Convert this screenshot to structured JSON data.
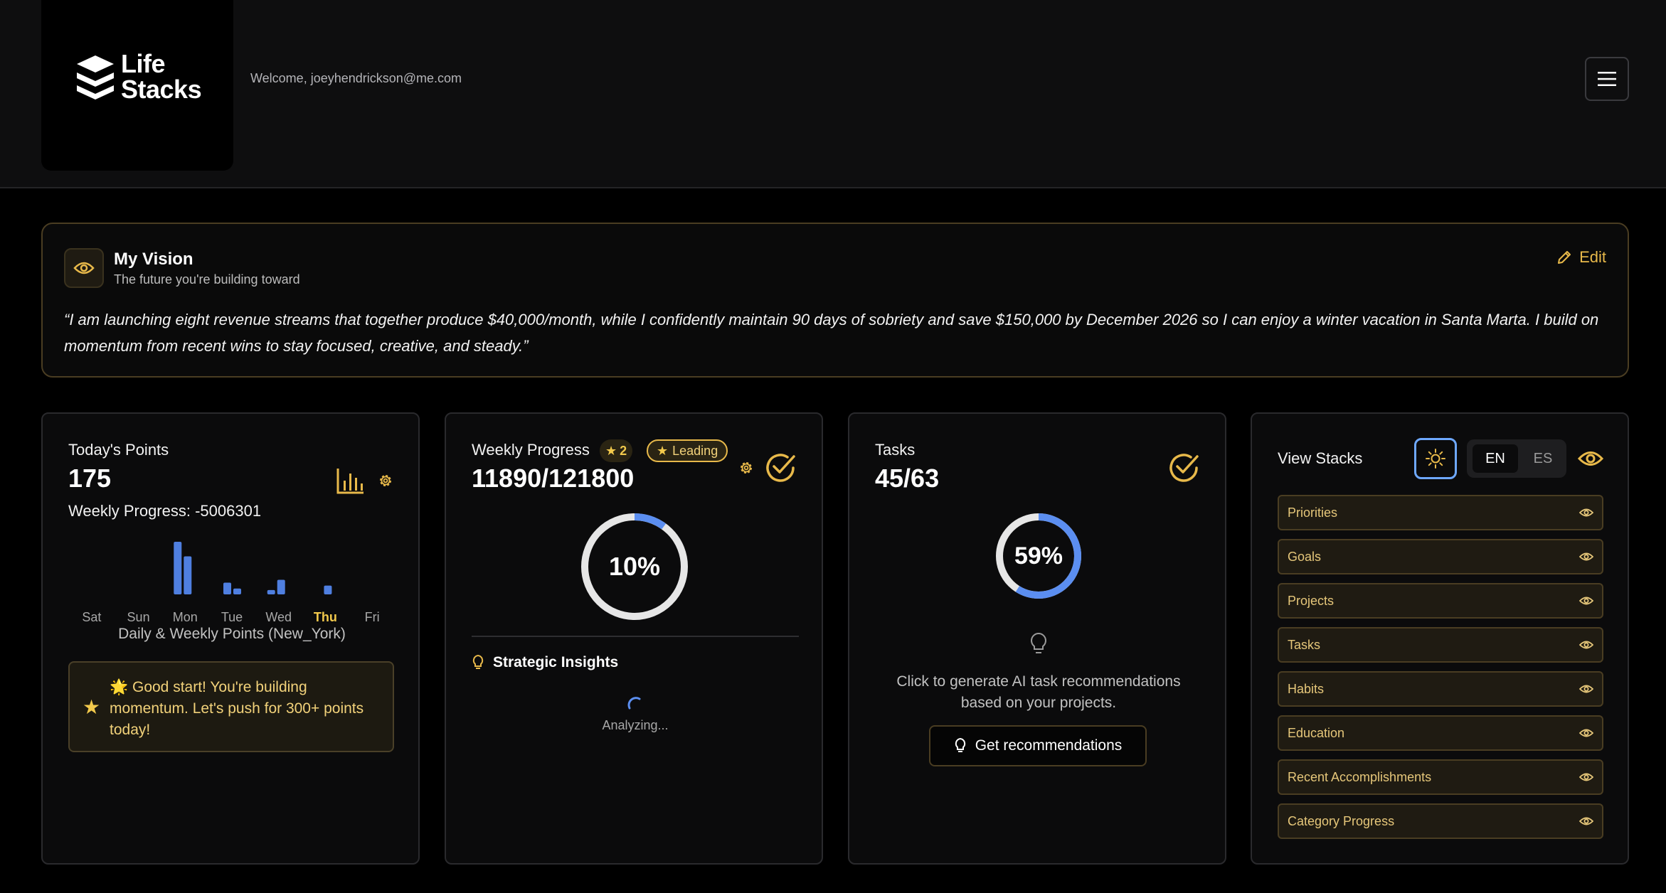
{
  "app": {
    "logo_line1": "Life",
    "logo_line2": "Stacks",
    "welcome": "Welcome, joeyhendrickson@me.com"
  },
  "vision": {
    "title": "My Vision",
    "subtitle": "The future you're building toward",
    "edit_label": "Edit",
    "quote": "“I am launching eight revenue streams that together produce $40,000/month, while I confidently maintain 90 days of sobriety and save $150,000 by December 2026 so I can enjoy a winter vacation in Santa Marta. I build on momentum from recent wins to stay focused, creative, and steady.”"
  },
  "points": {
    "label": "Today's Points",
    "value": "175",
    "weekly": "Weekly Progress: -5006301",
    "caption": "Daily & Weekly Points (New_York)",
    "tip": "🌟 Good start! You're building momentum. Let's push for 300+ points today!"
  },
  "chart_data": {
    "type": "bar",
    "categories": [
      "Sat",
      "Sun",
      "Mon",
      "Tue",
      "Wed",
      "Thu",
      "Fri"
    ],
    "highlight": "Thu",
    "series": [
      {
        "values": [
          0,
          0,
          72,
          16,
          6,
          0,
          0
        ]
      },
      {
        "values": [
          0,
          0,
          52,
          8,
          20,
          12,
          0
        ]
      }
    ],
    "title": "Daily & Weekly Points (New_York)",
    "color": "#4f7fe0",
    "highlight_color": "#f2c94c"
  },
  "weekly_progress": {
    "label": "Weekly Progress",
    "star_count": "2",
    "leading_label": "Leading",
    "value": "11890/121800",
    "percent_label": "10%",
    "percent": 10,
    "insights_label": "Strategic Insights",
    "analyzing": "Analyzing..."
  },
  "tasks": {
    "label": "Tasks",
    "value": "45/63",
    "percent_label": "59%",
    "percent": 59,
    "prompt": "Click to generate AI task recommendations based on your projects.",
    "button_label": "Get recommendations"
  },
  "view_stacks": {
    "title": "View Stacks",
    "lang_en": "EN",
    "lang_es": "ES",
    "items": [
      {
        "label": "Priorities"
      },
      {
        "label": "Goals"
      },
      {
        "label": "Projects"
      },
      {
        "label": "Tasks"
      },
      {
        "label": "Habits"
      },
      {
        "label": "Education"
      },
      {
        "label": "Recent Accomplishments"
      },
      {
        "label": "Category Progress"
      }
    ]
  },
  "colors": {
    "accent": "#e8b94a",
    "ring_track": "#e6e6e6",
    "ring_fill": "#5b8ef0"
  }
}
